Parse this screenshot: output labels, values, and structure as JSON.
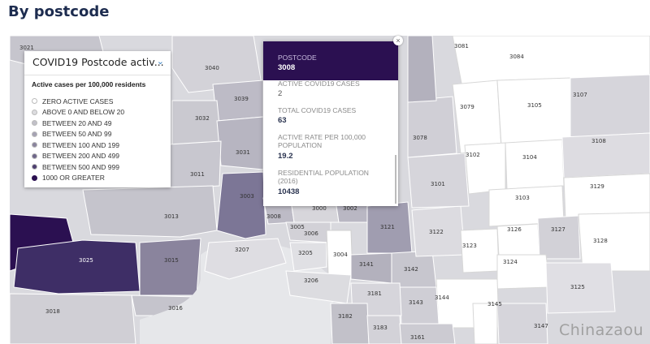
{
  "page": {
    "title": "By postcode"
  },
  "legend": {
    "select_label": "COVID19 Postcode activ...",
    "subtitle": "Active cases per 100,000 residents",
    "items": [
      {
        "label": "ZERO ACTIVE CASES",
        "color": "#ffffff"
      },
      {
        "label": "ABOVE 0 AND BELOW 20",
        "color": "#dcdcdf"
      },
      {
        "label": "BETWEEN 20 AND 49",
        "color": "#c1c0c8"
      },
      {
        "label": "BETWEEN 50 AND 99",
        "color": "#a5a2b3"
      },
      {
        "label": "BETWEEN 100 AND 199",
        "color": "#8a849d"
      },
      {
        "label": "BETWEEN 200 AND 499",
        "color": "#6e6689"
      },
      {
        "label": "BETWEEN 500 AND 999",
        "color": "#4e3f70"
      },
      {
        "label": "1000 OR GREATER",
        "color": "#2b1051"
      }
    ]
  },
  "popup": {
    "postcode_label": "POSTCODE",
    "postcode_value": "3008",
    "active_label": "ACTIVE COVID19 CASES",
    "active_value": "2",
    "total_label": "TOTAL COVID19 CASES",
    "total_value": "63",
    "rate_label_1": "ACTIVE RATE PER 100,000",
    "rate_label_2": "POPULATION",
    "rate_value": "19.2",
    "res_label_1": "RESIDENTIAL POPULATION",
    "res_label_2": "(2016)",
    "res_value": "10438"
  },
  "watermark": "Chinazaou",
  "postcodes": {
    "p3021": "3021",
    "p3040": "3040",
    "p3039": "3039",
    "p3032": "3032",
    "p3031": "3031",
    "p3011": "3011",
    "p3003": "3003",
    "p3013": "3013",
    "p3025": "3025",
    "p3015": "3015",
    "p3016": "3016",
    "p3018": "3018",
    "p3207": "3207",
    "p3008": "3008",
    "p3005": "3005",
    "p3006": "3006",
    "p3000": "3000",
    "p3002": "3002",
    "p3205": "3205",
    "p3004": "3004",
    "p3206": "3206",
    "p3141": "3141",
    "p3142": "3142",
    "p3121": "3121",
    "p3122": "3122",
    "p3101": "3101",
    "p3078": "3078",
    "p3081": "3081",
    "p3084": "3084",
    "p3079": "3079",
    "p3105": "3105",
    "p3107": "3107",
    "p3102": "3102",
    "p3104": "3104",
    "p3108": "3108",
    "p3103": "3103",
    "p3129": "3129",
    "p3126": "3126",
    "p3127": "3127",
    "p3128": "3128",
    "p3123": "3123",
    "p3124": "3124",
    "p3125": "3125",
    "p3144": "3144",
    "p3143": "3143",
    "p3181": "3181",
    "p3182": "3182",
    "p3183": "3183",
    "p3161": "3161",
    "p3147": "3147",
    "p3145": "3145"
  }
}
